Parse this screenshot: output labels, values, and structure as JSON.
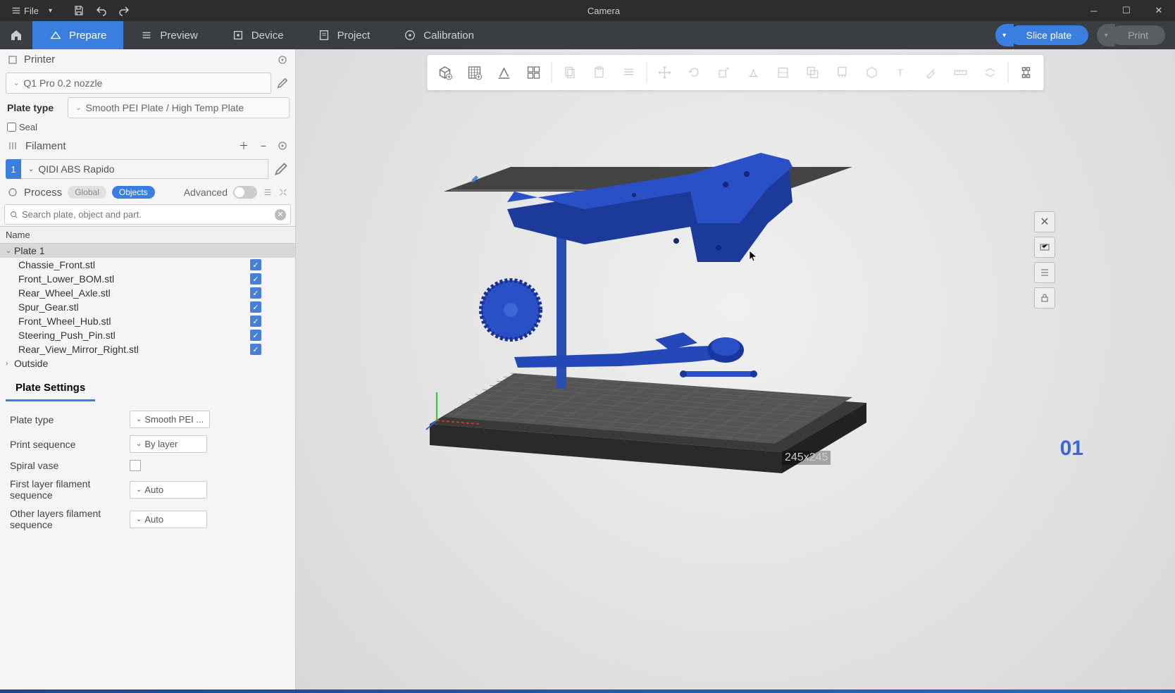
{
  "titlebar": {
    "file_label": "File",
    "title": "Camera"
  },
  "tabs": {
    "prepare": "Prepare",
    "preview": "Preview",
    "device": "Device",
    "project": "Project",
    "calibration": "Calibration"
  },
  "actions": {
    "slice": "Slice plate",
    "print": "Print"
  },
  "printer": {
    "section": "Printer",
    "selected": "Q1 Pro 0.2 nozzle",
    "plate_type_label": "Plate type",
    "plate_type_value": "Smooth PEI Plate / High Temp Plate",
    "seal_label": "Seal"
  },
  "filament": {
    "section": "Filament",
    "items": [
      {
        "num": "1",
        "name": "QIDI ABS Rapido"
      }
    ]
  },
  "process": {
    "section": "Process",
    "global": "Global",
    "objects": "Objects",
    "advanced": "Advanced",
    "search_placeholder": "Search plate, object and part."
  },
  "tree": {
    "header": "Name",
    "plate": "Plate 1",
    "items": [
      "Chassie_Front.stl",
      "Front_Lower_BOM.stl",
      "Rear_Wheel_Axle.stl",
      "Spur_Gear.stl",
      "Front_Wheel_Hub.stl",
      "Steering_Push_Pin.stl",
      "Rear_View_Mirror_Right.stl"
    ],
    "outside": "Outside"
  },
  "plate_settings": {
    "header": "Plate Settings",
    "rows": {
      "plate_type": {
        "label": "Plate type",
        "value": "Smooth PEI ..."
      },
      "print_sequence": {
        "label": "Print sequence",
        "value": "By layer"
      },
      "spiral_vase": {
        "label": "Spiral vase"
      },
      "first_layer": {
        "label": "First layer filament sequence",
        "value": "Auto"
      },
      "other_layers": {
        "label": "Other layers filament sequence",
        "value": "Auto"
      }
    }
  },
  "viewport": {
    "plate_number": "01",
    "dimensions": "245x245"
  }
}
